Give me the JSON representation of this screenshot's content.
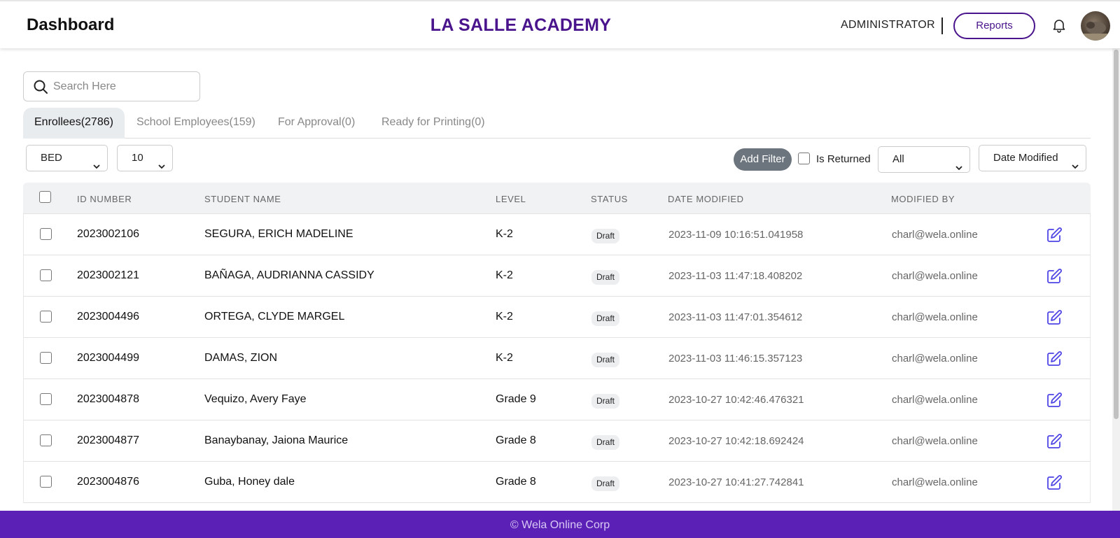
{
  "header": {
    "title": "Dashboard",
    "school_name": "LA SALLE ACADEMY",
    "role": "ADMINISTRATOR",
    "reports_label": "Reports"
  },
  "search": {
    "placeholder": "Search Here",
    "value": ""
  },
  "tabs": [
    {
      "label": "Enrollees(2786)",
      "active": true
    },
    {
      "label": "School Employees(159)",
      "active": false
    },
    {
      "label": "For Approval(0)",
      "active": false
    },
    {
      "label": "Ready for Printing(0)",
      "active": false
    }
  ],
  "filters": {
    "department": "BED",
    "page_size": "10",
    "add_filter_label": "Add Filter",
    "is_returned_label": "Is Returned",
    "is_returned_checked": false,
    "status_filter": "All",
    "sort_by": "Date Modified"
  },
  "table": {
    "columns": [
      "ID NUMBER",
      "STUDENT NAME",
      "LEVEL",
      "STATUS",
      "DATE MODIFIED",
      "MODIFIED BY"
    ],
    "rows": [
      {
        "id": "2023002106",
        "name": "SEGURA, ERICH MADELINE",
        "level": "K-2",
        "status": "Draft",
        "date_modified": "2023-11-09 10:16:51.041958",
        "modified_by": "charl@wela.online"
      },
      {
        "id": "2023002121",
        "name": "BAÑAGA, AUDRIANNA CASSIDY",
        "level": "K-2",
        "status": "Draft",
        "date_modified": "2023-11-03 11:47:18.408202",
        "modified_by": "charl@wela.online"
      },
      {
        "id": "2023004496",
        "name": "ORTEGA, CLYDE MARGEL",
        "level": "K-2",
        "status": "Draft",
        "date_modified": "2023-11-03 11:47:01.354612",
        "modified_by": "charl@wela.online"
      },
      {
        "id": "2023004499",
        "name": "DAMAS, ZION",
        "level": "K-2",
        "status": "Draft",
        "date_modified": "2023-11-03 11:46:15.357123",
        "modified_by": "charl@wela.online"
      },
      {
        "id": "2023004878",
        "name": "Vequizo, Avery Faye",
        "level": "Grade 9",
        "status": "Draft",
        "date_modified": "2023-10-27 10:42:46.476321",
        "modified_by": "charl@wela.online"
      },
      {
        "id": "2023004877",
        "name": "Banaybanay, Jaiona Maurice",
        "level": "Grade 8",
        "status": "Draft",
        "date_modified": "2023-10-27 10:42:18.692424",
        "modified_by": "charl@wela.online"
      },
      {
        "id": "2023004876",
        "name": "Guba, Honey dale",
        "level": "Grade 8",
        "status": "Draft",
        "date_modified": "2023-10-27 10:41:27.742841",
        "modified_by": "charl@wela.online"
      }
    ]
  },
  "footer": {
    "text": "© Wela Online Corp"
  },
  "colors": {
    "brand": "#4a148c",
    "footer_bg": "#5b21b6",
    "edit_icon": "#4f46e5",
    "add_filter_bg": "#6c757d"
  },
  "icons": {
    "search": "search-icon",
    "bell": "bell-icon",
    "edit": "edit-icon",
    "chevron": "chevron-down-icon"
  }
}
